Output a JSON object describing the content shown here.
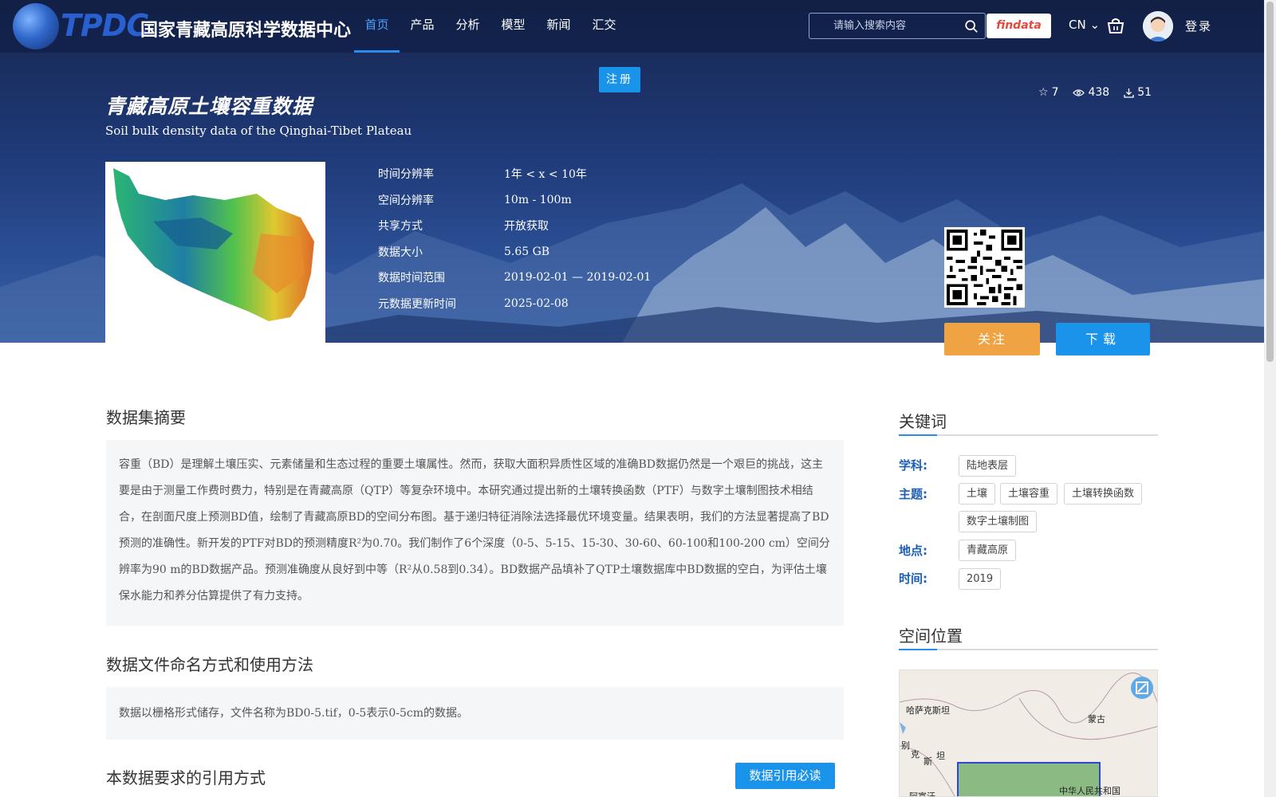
{
  "header": {
    "logo_abbr": "TPDC",
    "site_name": "国家青藏高原科学数据中心",
    "nav": [
      {
        "label": "首页",
        "active": true
      },
      {
        "label": "产品"
      },
      {
        "label": "分析"
      },
      {
        "label": "模型"
      },
      {
        "label": "新闻"
      },
      {
        "label": "汇交"
      }
    ],
    "search_placeholder": "请输入搜索内容",
    "findata_label": "findata",
    "lang": "CN",
    "login_label": "登录",
    "register_label": "注册"
  },
  "dataset": {
    "title_cn": "青藏高原土壤容重数据",
    "title_en": "Soil bulk density data of the Qinghai-Tibet Plateau",
    "stats": {
      "favorites": "7",
      "views": "438",
      "downloads": "51"
    },
    "meta": [
      {
        "key": "时间分辨率",
        "value": "1年 < x < 10年"
      },
      {
        "key": "空间分辨率",
        "value": "10m - 100m"
      },
      {
        "key": "共享方式",
        "value": "开放获取"
      },
      {
        "key": "数据大小",
        "value": "5.65 GB"
      },
      {
        "key": "数据时间范围",
        "value": "2019-02-01 — 2019-02-01"
      },
      {
        "key": "元数据更新时间",
        "value": "2025-02-08"
      }
    ],
    "follow_label": "关注",
    "download_label": "下载"
  },
  "main": {
    "abstract_title": "数据集摘要",
    "abstract_text": "容重（BD）是理解土壤压实、元素储量和生态过程的重要土壤属性。然而，获取大面积异质性区域的准确BD数据仍然是一个艰巨的挑战，这主要是由于测量工作费时费力，特别是在青藏高原（QTP）等复杂环境中。本研究通过提出新的土壤转换函数（PTF）与数字土壤制图技术相结合，在剖面尺度上预测BD值，绘制了青藏高原BD的空间分布图。基于递归特征消除法选择最优环境变量。结果表明，我们的方法显著提高了BD预测的准确性。新开发的PTF对BD的预测精度R²为0.70。我们制作了6个深度（0-5、5-15、15-30、30-60、60-100和100-200 cm）空间分辨率为90 m的BD数据产品。预测准确度从良好到中等（R²从0.58到0.34）。BD数据产品填补了QTP土壤数据库中BD数据的空白，为评估土壤保水能力和养分估算提供了有力支持。",
    "naming_title": "数据文件命名方式和使用方法",
    "naming_text": "数据以栅格形式储存，文件名称为BD0-5.tif，0-5表示0-5cm的数据。",
    "citation_title": "本数据要求的引用方式",
    "citation_button": "数据引用必读"
  },
  "sidebar": {
    "keywords_title": "关键词",
    "subject_label": "学科:",
    "subject_tags": [
      "陆地表层"
    ],
    "theme_label": "主题:",
    "theme_tags": [
      "土壤",
      "土壤容重",
      "土壤转换函数",
      "数字土壤制图"
    ],
    "place_label": "地点:",
    "place_tags": [
      "青藏高原"
    ],
    "time_label": "时间:",
    "time_tags": [
      "2019"
    ],
    "location_title": "空间位置",
    "map_labels": [
      "哈萨克斯坦",
      "蒙古",
      "别",
      "克",
      "斯",
      "坦",
      "中华人民共和国",
      "阿富汗"
    ]
  }
}
